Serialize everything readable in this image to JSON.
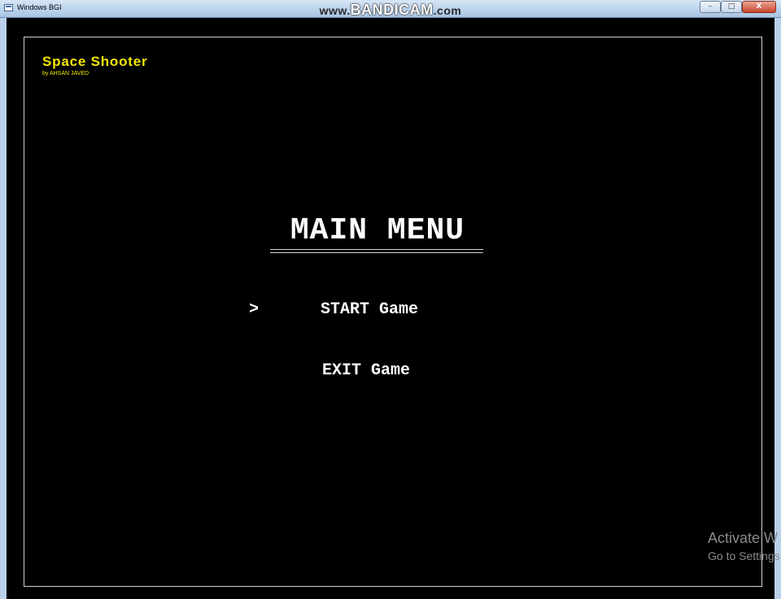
{
  "window": {
    "title": "Windows BGI",
    "watermark_prefix": "www.",
    "watermark_brand": "BANDICAM",
    "watermark_suffix": ".com",
    "controls": {
      "minimize": "–",
      "maximize": "□",
      "close": "X"
    }
  },
  "game": {
    "title": "Space Shooter",
    "author": "by AHSAN JAVED",
    "menu": {
      "heading": "MAIN MENU",
      "cursor": ">",
      "items": [
        {
          "label": "START Game",
          "selected": true
        },
        {
          "label": "EXIT Game",
          "selected": false
        }
      ]
    },
    "colors": {
      "title": "#f2e600",
      "text": "#ffffff",
      "background": "#000000",
      "border": "#d0d0d0"
    }
  },
  "os_overlay": {
    "line1": "Activate W",
    "line2": "Go to Settings"
  }
}
